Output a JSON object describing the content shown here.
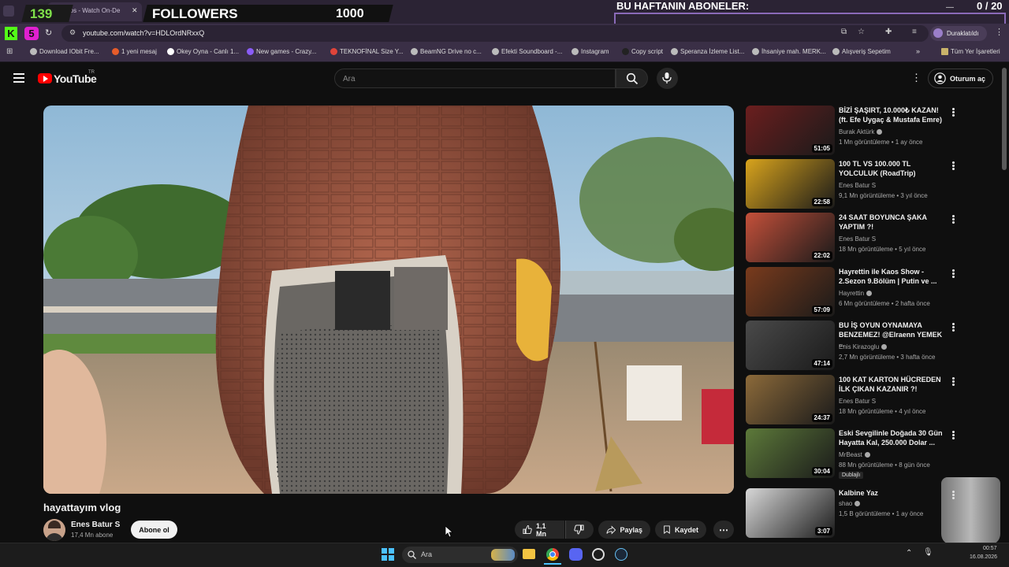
{
  "stream_overlay": {
    "counter": "139",
    "followers_label": "FOLLOWERS",
    "followers_count": "1000",
    "subscribers_label": "BU HAFTANIN ABONELER:",
    "subscribers_progress": "0 / 20"
  },
  "browser": {
    "tab_title": "ideos - Watch On-De",
    "url": "youtube.com/watch?v=HDLOrdNRxxQ",
    "paused_label": "Duraklatıldı",
    "bookmarks": [
      "Download IObit Fre...",
      "1 yeni mesaj",
      "Okey Oyna - Canlı 1...",
      "New games - Crazy...",
      "TEKNOFİNAL Size Y...",
      "BeamNG Drive no c...",
      "Efekti Soundboard -...",
      "Instagram",
      "Copy script",
      "Speranza İzleme List...",
      "İhsaniye mah. MERK...",
      "Alışveriş Sepetim"
    ],
    "all_bookmarks": "Tüm Yer İşaretleri"
  },
  "youtube": {
    "logo_text": "YouTube",
    "region": "TR",
    "search_placeholder": "Ara",
    "signin_label": "Oturum aç"
  },
  "video": {
    "title": "hayattayım vlog",
    "channel": "Enes Batur S",
    "subscribers": "17,4 Mn abone",
    "subscribe_label": "Abone ol",
    "likes": "1,1 Mn",
    "share_label": "Paylaş",
    "save_label": "Kaydet"
  },
  "recommendations": [
    {
      "title": "BİZİ ŞAŞIRT, 10.000₺ KAZAN! (ft. Efe Uygaç & Mustafa Emre)",
      "channel": "Burak Aktürk",
      "views": "1 Mn görüntüleme",
      "age": "1 ay önce",
      "duration": "51:05",
      "thumb_color": "#6b1e1e"
    },
    {
      "title": "100 TL VS 100.000 TL YOLCULUK (RoadTrip)",
      "channel": "Enes Batur S",
      "views": "9,1 Mn görüntüleme",
      "age": "3 yıl önce",
      "duration": "22:58",
      "thumb_color": "#d9a41c"
    },
    {
      "title": "24 SAAT BOYUNCA ŞAKA YAPTIM ?!",
      "channel": "Enes Batur S",
      "views": "18 Mn görüntüleme",
      "age": "5 yıl önce",
      "duration": "22:02",
      "thumb_color": "#c4503a"
    },
    {
      "title": "Hayrettin ile Kaos Show - 2.Sezon 9.Bölüm | Putin ve ...",
      "channel": "Hayrettin",
      "views": "6 Mn görüntüleme",
      "age": "2 hafta önce",
      "duration": "57:09",
      "thumb_color": "#7a3b1c"
    },
    {
      "title": "BU İŞ OYUN OYNAMAYA BENZEMEZ! @Elraenn YEMEK ...",
      "channel": "Enis Kirazoglu",
      "views": "2,7 Mn görüntüleme",
      "age": "3 hafta önce",
      "duration": "47:14",
      "thumb_color": "#4a4a4a"
    },
    {
      "title": "100 KAT KARTON HÜCREDEN İLK ÇIKAN KAZANIR ?!",
      "channel": "Enes Batur S",
      "views": "18 Mn görüntüleme",
      "age": "4 yıl önce",
      "duration": "24:37",
      "thumb_color": "#8c6a3a"
    },
    {
      "title": "Eski Sevgilinle Doğada 30 Gün Hayatta Kal, 250.000 Dolar ...",
      "channel": "MrBeast",
      "views": "88 Mn görüntüleme",
      "age": "8 gün önce",
      "duration": "30:04",
      "badge": "Dublajlı",
      "thumb_color": "#5d7a3a"
    },
    {
      "title": "Kalbine Yaz",
      "channel": "shao",
      "views": "1,5 B görüntüleme",
      "age": "1 ay önce",
      "duration": "3:07",
      "thumb_color": "#d8d8d8"
    }
  ],
  "taskbar": {
    "search_placeholder": "Ara",
    "clock_time": "00:57",
    "clock_date": "16.08.2026"
  }
}
